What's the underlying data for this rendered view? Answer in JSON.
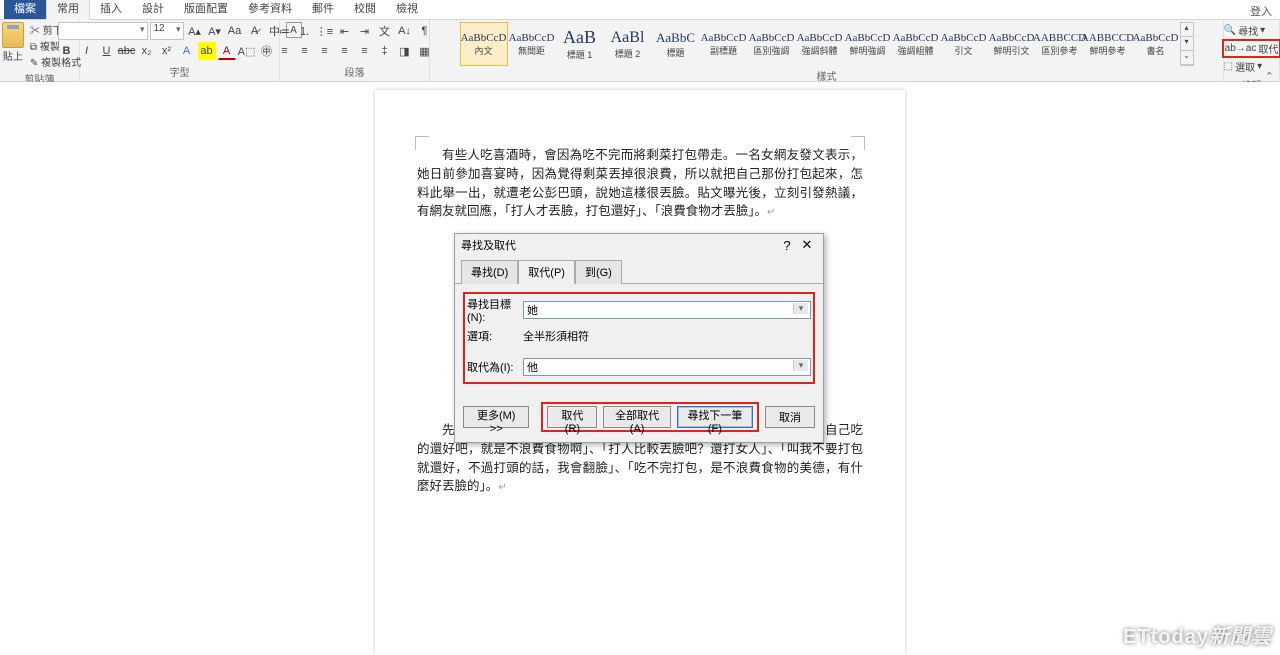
{
  "tabs": {
    "file": "檔案",
    "home": "常用",
    "insert": "插入",
    "design": "設計",
    "layout": "版面配置",
    "references": "參考資料",
    "mailings": "郵件",
    "review": "校閱",
    "view": "檢視",
    "signin": "登入"
  },
  "clipboard": {
    "paste": "貼上",
    "cut": "剪下",
    "copy": "複製",
    "painter": "複製格式",
    "group": "剪貼簿"
  },
  "font": {
    "size": "12",
    "grow": "A",
    "shrink": "A",
    "case": "Aa",
    "clear": "A",
    "bold": "B",
    "italic": "I",
    "underline": "U",
    "strike": "abc",
    "sub": "x₂",
    "sup": "x²",
    "effects": "A",
    "highlight": "ab",
    "color": "A",
    "ruby": "中",
    "border": "A",
    "group": "字型"
  },
  "paragraph": {
    "group": "段落"
  },
  "styles_group": "樣式",
  "styles": [
    {
      "preview": "AaBbCcD",
      "name": "內文",
      "size": "11px"
    },
    {
      "preview": "AaBbCcD",
      "name": "無間距",
      "size": "11px"
    },
    {
      "preview": "AaB",
      "name": "標題 1",
      "size": "18px"
    },
    {
      "preview": "AaBl",
      "name": "標題 2",
      "size": "16px"
    },
    {
      "preview": "AaBbC",
      "name": "標題",
      "size": "13px"
    },
    {
      "preview": "AaBbCcD",
      "name": "副標題",
      "size": "11px"
    },
    {
      "preview": "AaBbCcD",
      "name": "區別強調",
      "size": "11px"
    },
    {
      "preview": "AaBbCcD",
      "name": "強調斜體",
      "size": "11px"
    },
    {
      "preview": "AaBbCcD",
      "name": "鮮明強調",
      "size": "11px"
    },
    {
      "preview": "AaBbCcD",
      "name": "強調組體",
      "size": "11px"
    },
    {
      "preview": "AaBbCcD",
      "name": "引文",
      "size": "11px"
    },
    {
      "preview": "AaBbCcD",
      "name": "鮮明引文",
      "size": "11px"
    },
    {
      "preview": "AABBCCD",
      "name": "區別參考",
      "size": "11px"
    },
    {
      "preview": "AABBCCD",
      "name": "鮮明參考",
      "size": "11px"
    },
    {
      "preview": "AaBbCcD",
      "name": "書名",
      "size": "11px"
    }
  ],
  "editing": {
    "find": "尋找",
    "replace": "取代",
    "select": "選取",
    "group": "編輯"
  },
  "document": {
    "p1": "有些人吃喜酒時，會因為吃不完而將剩菜打包帶走。一名女網友發文表示，她日前參加喜宴時，因為覺得剩菜丟掉很浪費，所以就把自己那份打包起來，怎料此舉一出，就遭老公彭巴頭，說她這樣很丟臉。貼文曝光後，立刻引發熱議，有網友就回應，「打人才丟臉，打包還好」、「浪費食物才丟臉」。",
    "p2": "先問過同桌的有沒有要包」、「會包很正常啊，幹嘛浪費食材」、「打包自己吃的還好吧，就是不浪費食物啊」、「打人比較丟臉吧？還打女人」、「叫我不要打包就還好，不過打頭的話，我會翻臉」、「吃不完打包，是不浪費食物的美德，有什麼好丟臉的」。"
  },
  "dialog": {
    "title": "尋找及取代",
    "tab_find": "尋找(D)",
    "tab_replace": "取代(P)",
    "tab_goto": "到(G)",
    "find_label": "尋找目標(N):",
    "find_value": "她",
    "options_label": "選項:",
    "options_value": "全半形須相符",
    "replace_label": "取代為(I):",
    "replace_value": "他",
    "more": "更多(M) >>",
    "btn_replace": "取代(R)",
    "btn_replace_all": "全部取代(A)",
    "btn_find_next": "尋找下一筆(F)",
    "btn_cancel": "取消"
  },
  "watermark": {
    "brand": "ETtoday",
    "suffix": "新聞雲"
  }
}
